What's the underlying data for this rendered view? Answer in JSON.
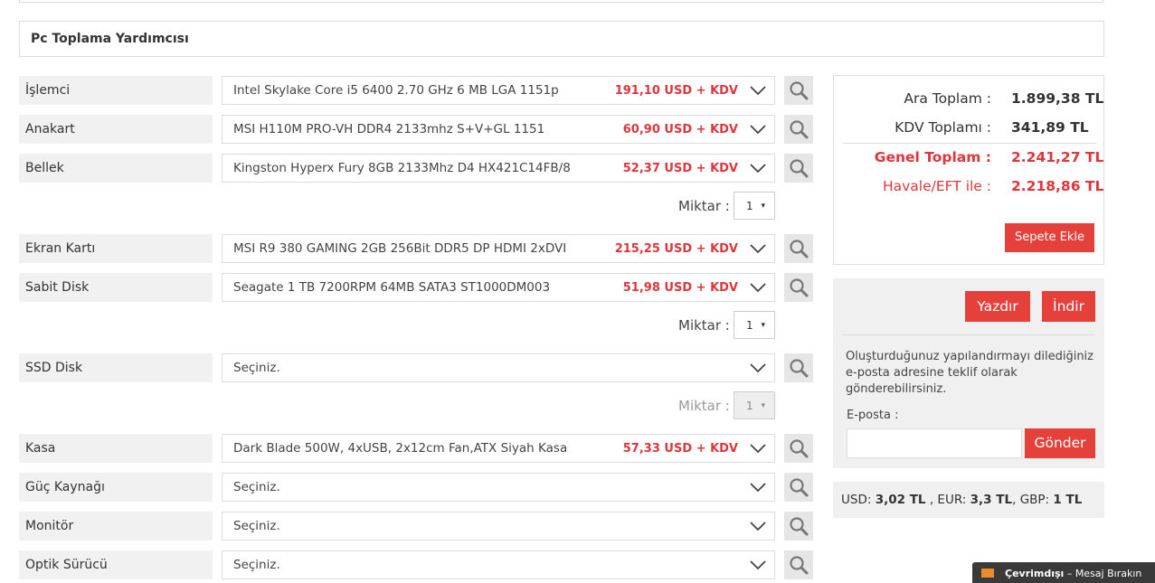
{
  "page": {
    "title": "Pc Toplama Yardımcısı"
  },
  "rows": [
    {
      "label": "İşlemci",
      "selected": "Intel Skylake Core i5 6400 2.70 GHz 6 MB LGA 1151p",
      "price": "191,10 USD + KDV"
    },
    {
      "label": "Anakart",
      "selected": "MSI H110M PRO-VH DDR4 2133mhz S+V+GL 1151",
      "price": "60,90 USD + KDV"
    },
    {
      "label": "Bellek",
      "selected": "Kingston Hyperx Fury 8GB 2133Mhz D4 HX421C14FB/8",
      "price": "52,37 USD + KDV"
    },
    {
      "label": "Ekran Kartı",
      "selected": "MSI R9 380 GAMING 2GB 256Bit DDR5 DP HDMI 2xDVI",
      "price": "215,25 USD + KDV"
    },
    {
      "label": "Sabit Disk",
      "selected": "Seagate 1 TB 7200RPM 64MB SATA3 ST1000DM003",
      "price": "51,98 USD + KDV"
    },
    {
      "label": "SSD Disk",
      "selected": "Seçiniz.",
      "price": ""
    },
    {
      "label": "Kasa",
      "selected": "Dark Blade 500W, 4xUSB, 2x12cm Fan,ATX Siyah Kasa",
      "price": "57,33 USD + KDV"
    },
    {
      "label": "Güç Kaynağı",
      "selected": "Seçiniz.",
      "price": ""
    },
    {
      "label": "Monitör",
      "selected": "Seçiniz.",
      "price": ""
    },
    {
      "label": "Optik Sürücü",
      "selected": "Seçiniz.",
      "price": ""
    }
  ],
  "quantities": [
    {
      "label": "Miktar :",
      "value": "1",
      "arrow": "▾"
    },
    {
      "label": "Miktar :",
      "value": "1",
      "arrow": "▾"
    },
    {
      "label": "Miktar :",
      "value": "1",
      "arrow": "▾"
    }
  ],
  "summary": {
    "ara_toplam_label": "Ara Toplam :",
    "ara_toplam_value": "1.899,38 TL",
    "kdv_label": "KDV Toplamı :",
    "kdv_value": "341,89 TL",
    "genel_label": "Genel Toplam :",
    "genel_value": "2.241,27 TL",
    "havale_label": "Havale/EFT ile :",
    "havale_value": "2.218,86 TL",
    "add_to_cart": "Sepete Ekle"
  },
  "share": {
    "print": "Yazdır",
    "download": "İndir",
    "description": "Oluşturduğunuz yapılandırmayı dilediğiniz e-posta adresine teklif olarak gönderebilirsiniz.",
    "email_label": "E-posta :",
    "email_value": "",
    "send": "Gönder"
  },
  "rates": {
    "usd_label": "USD:",
    "usd_value": "3,02 TL",
    "sep1": ",",
    "eur_label": "EUR:",
    "eur_value": "3,3 TL",
    "sep2": ",",
    "gbp_label": "GBP:",
    "gbp_value": "1 TL"
  },
  "chat": {
    "status": "Çevrimdışı",
    "message": " – Mesaj Bırakın"
  },
  "colors": {
    "accent": "#e5413a",
    "price": "#e0363b",
    "label_bg": "#f1f1f1"
  },
  "icons": {
    "search": "magnifier-icon",
    "dropdown": "chevron-down-icon",
    "chat": "envelope-icon"
  }
}
